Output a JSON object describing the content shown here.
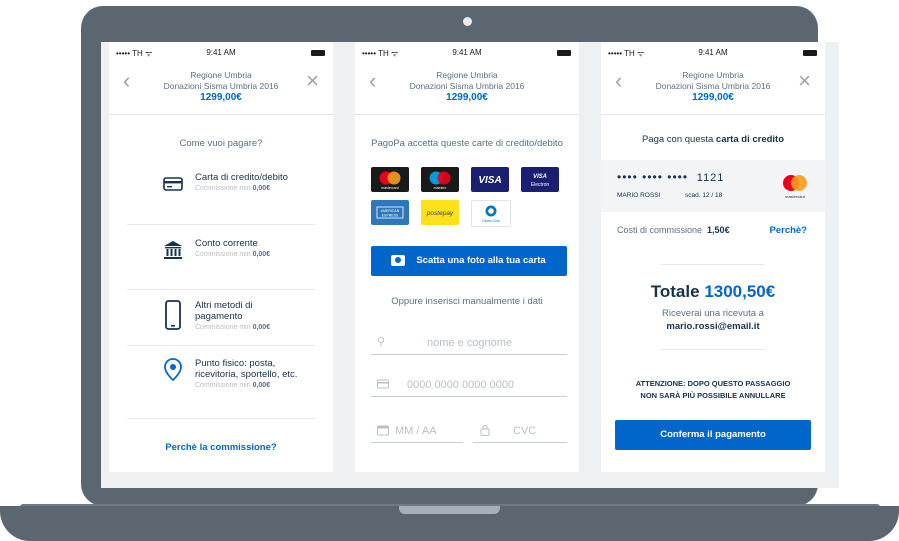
{
  "status": {
    "carrier": "••••• TH ᯤ",
    "time": "9:41 AM"
  },
  "header": {
    "region": "Regione Umbria",
    "title": "Donazioni Sisma Umbria 2016",
    "amount": "1299,00€"
  },
  "screen1": {
    "question": "Come vuoi pagare?",
    "methods": [
      {
        "label": "Carta di credito/debito",
        "fee_label": "Commissione min",
        "fee": "0,00€",
        "icon": "credit-card-icon"
      },
      {
        "label": "Conto corrente",
        "fee_label": "Commissione min",
        "fee": "0,00€",
        "icon": "bank-icon"
      },
      {
        "label": "Altri metodi di pagamento",
        "fee_label": "Commissione min",
        "fee": "0,00€",
        "icon": "smartphone-icon"
      },
      {
        "label": "Punto fisico: posta, ricevitoria, sportello, etc.",
        "fee_label": "Commissione min",
        "fee": "0,00€",
        "icon": "location-pin-icon"
      }
    ],
    "link": "Perchè la commissione?"
  },
  "screen2": {
    "intro": "PagoPa accetta queste carte di credito/debito",
    "cards": [
      {
        "name": "mastercard",
        "label": "mastercard"
      },
      {
        "name": "maestro",
        "label": "maestro"
      },
      {
        "name": "visa",
        "label": "VISA"
      },
      {
        "name": "visa-electron",
        "label": "VISA Electron"
      },
      {
        "name": "american-express",
        "label": "AMERICAN EXPRESS"
      },
      {
        "name": "postepay",
        "label": "postepay"
      },
      {
        "name": "diners-club",
        "label": "Diners Club"
      }
    ],
    "photo_button": "Scatta una foto alla tua carta",
    "manual_label": "Oppure inserisci manualmente i dati",
    "name_placeholder": "nome e cognome",
    "number_placeholder": "0000 0000 0000 0000",
    "expiry_placeholder": "MM / AA",
    "cvc_placeholder": "CVC"
  },
  "screen3": {
    "intro_plain": "Paga con questa ",
    "intro_bold": "carta di credito",
    "card_masked": "•••• •••• ••••",
    "card_last": "1121",
    "card_holder": "MARIO ROSSI",
    "card_expiry": "scad. 12 / 18",
    "card_brand": "mastercard",
    "fee_label": "Costi di commissione",
    "fee_value": "1,50€",
    "why_link": "Perchè?",
    "total_label": "Totale",
    "total_value": "1300,50€",
    "receipt_line": "Riceverai una ricevuta a",
    "receipt_email": "mario.rossi@email.it",
    "warning_1": "ATTENZIONE: DOPO QUESTO PASSAGGIO",
    "warning_2": "NON SARÀ PIÙ POSSIBILE ANNULLARE",
    "confirm_button": "Conferma il pagamento"
  },
  "colors": {
    "accent": "#0066cc",
    "text": "#17324d",
    "muted": "#5c6f82",
    "laptop": "#5b6670"
  }
}
